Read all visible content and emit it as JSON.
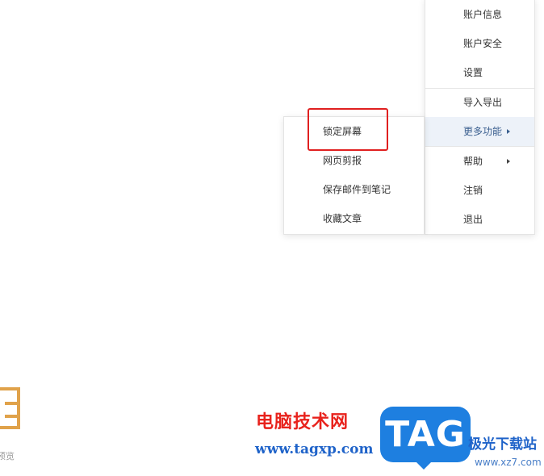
{
  "main_menu": {
    "items": [
      {
        "label": "账户信息"
      },
      {
        "label": "账户安全"
      },
      {
        "label": "设置"
      },
      {
        "label": "导入导出"
      },
      {
        "label": "更多功能",
        "submenu": true,
        "active": true
      },
      {
        "label": "帮助",
        "submenu": true
      },
      {
        "label": "注销"
      },
      {
        "label": "退出"
      }
    ]
  },
  "more_features_submenu": {
    "items": [
      {
        "label": "锁定屏幕",
        "highlighted": true
      },
      {
        "label": "网页剪报"
      },
      {
        "label": "保存邮件到笔记"
      },
      {
        "label": "收藏文章"
      }
    ]
  },
  "background": {
    "partial_label": "预览",
    "logo_icon": "app-logo-icon"
  },
  "watermark": {
    "site_name": "电脑技术网",
    "url": "www.tagxp.com",
    "tag_text": "TAG",
    "download_site": "极光下载站",
    "download_domain": "www.xz7.com"
  },
  "colors": {
    "highlight_box": "#e02020",
    "active_item_bg": "#edf2f9",
    "logo": "#e0a24a",
    "watermark_blue": "#1e7fe0",
    "watermark_red": "#e8221c"
  }
}
